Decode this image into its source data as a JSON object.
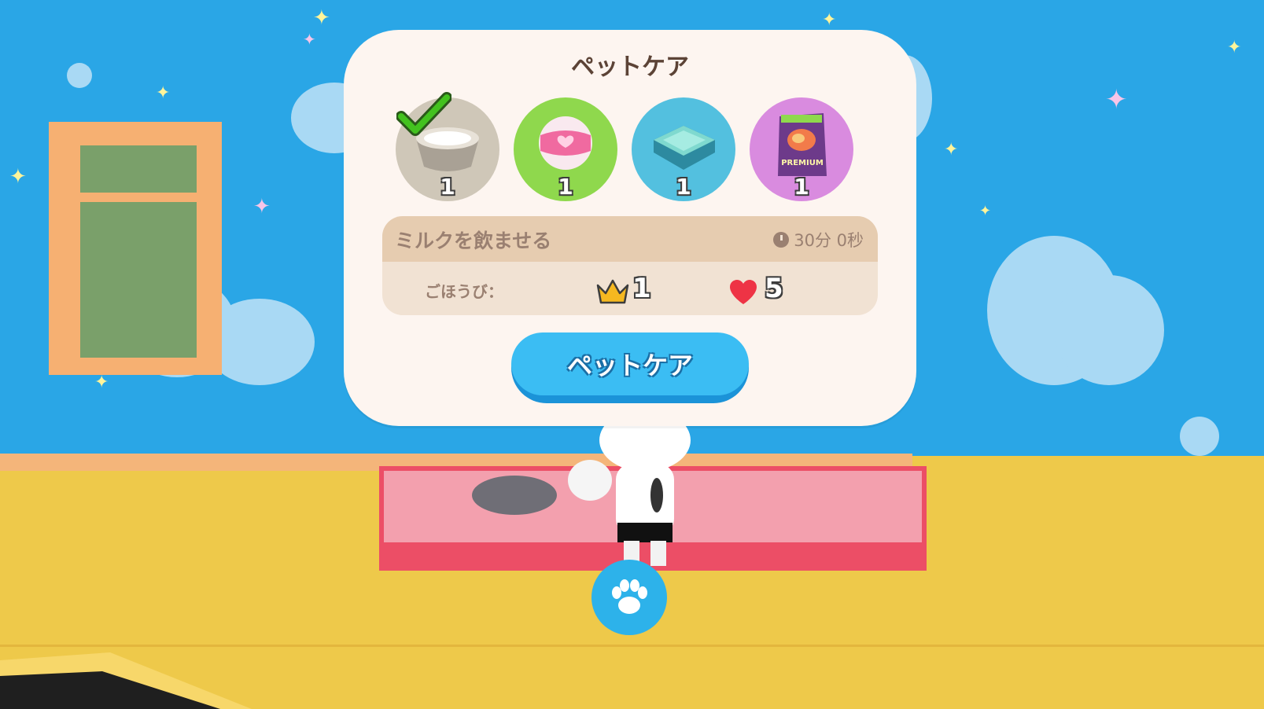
{
  "panel": {
    "title": "ペットケア",
    "items": [
      {
        "name": "milk-bowl",
        "count": "1",
        "selected": true,
        "bg": "#cfc7b8"
      },
      {
        "name": "toy-ball",
        "count": "1",
        "selected": false,
        "bg": "#8fd84d"
      },
      {
        "name": "pet-bed",
        "count": "1",
        "selected": false,
        "bg": "#53c0df"
      },
      {
        "name": "premium-food",
        "count": "1",
        "selected": false,
        "bg": "#d98bdf"
      }
    ],
    "premium_label": "PREMIUM",
    "task": "ミルクを飲ませる",
    "timer": "30分 0秒",
    "reward_label": "ごほうび：",
    "reward_crown": "1",
    "reward_heart": "5",
    "button_label": "ペットケア"
  },
  "colors": {
    "wall": "#2aa6e6",
    "floor": "#eec94a",
    "rug": "#ec4e66",
    "button": "#3bbdf3"
  }
}
